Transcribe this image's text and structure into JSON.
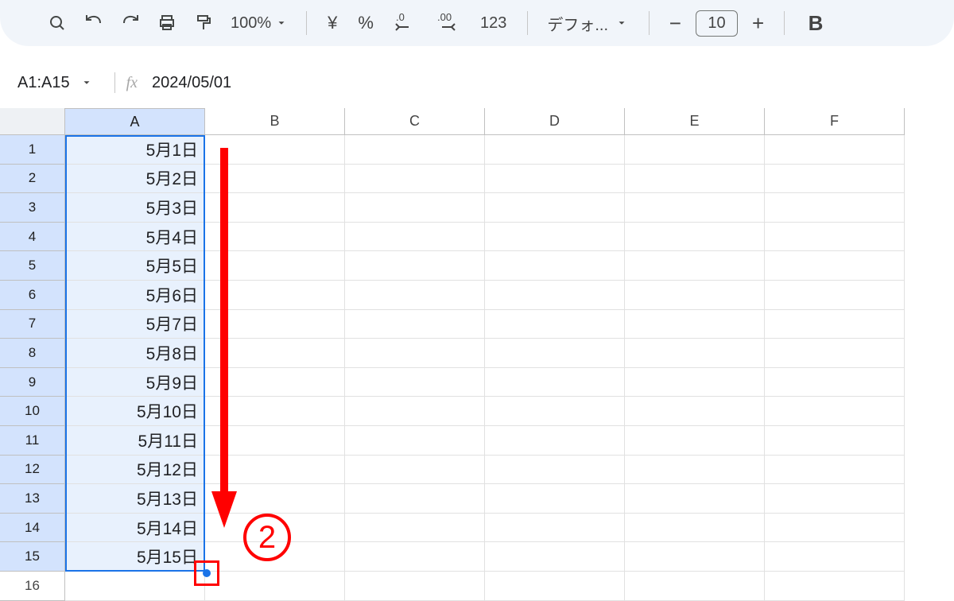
{
  "toolbar": {
    "zoom": "100%",
    "currency_symbol": "¥",
    "percent_symbol": "%",
    "number_text": "123",
    "font_label": "デフォ...",
    "font_size": "10",
    "bold": "B"
  },
  "formula": {
    "name_box": "A1:A15",
    "fx_label": "fx",
    "value": "2024/05/01"
  },
  "columns": [
    "A",
    "B",
    "C",
    "D",
    "E",
    "F"
  ],
  "rows": [
    {
      "n": "1",
      "a": "5月1日"
    },
    {
      "n": "2",
      "a": "5月2日"
    },
    {
      "n": "3",
      "a": "5月3日"
    },
    {
      "n": "4",
      "a": "5月4日"
    },
    {
      "n": "5",
      "a": "5月5日"
    },
    {
      "n": "6",
      "a": "5月6日"
    },
    {
      "n": "7",
      "a": "5月7日"
    },
    {
      "n": "8",
      "a": "5月8日"
    },
    {
      "n": "9",
      "a": "5月9日"
    },
    {
      "n": "10",
      "a": "5月10日"
    },
    {
      "n": "11",
      "a": "5月11日"
    },
    {
      "n": "12",
      "a": "5月12日"
    },
    {
      "n": "13",
      "a": "5月13日"
    },
    {
      "n": "14",
      "a": "5月14日"
    },
    {
      "n": "15",
      "a": "5月15日"
    },
    {
      "n": "16",
      "a": ""
    }
  ],
  "annotation": {
    "step_label": "2"
  }
}
